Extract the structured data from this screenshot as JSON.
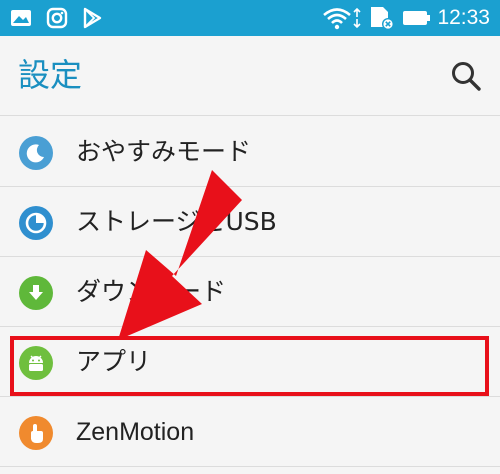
{
  "status_bar": {
    "time": "12:33",
    "left_icons": [
      "gallery-icon",
      "instagram-icon",
      "play-store-icon"
    ],
    "right_icons": [
      "wifi-icon",
      "sd-card-icon",
      "battery-icon"
    ]
  },
  "header": {
    "title": "設定",
    "search_icon": "search-icon"
  },
  "settings": {
    "items": [
      {
        "label": "おやすみモード",
        "icon": "moon-icon",
        "color": "#4a9fd4"
      },
      {
        "label": "ストレージとUSB",
        "icon": "storage-icon",
        "color": "#2f8fcf"
      },
      {
        "label": "ダウンロード",
        "icon": "download-icon",
        "color": "#5fb83a"
      },
      {
        "label": "アプリ",
        "icon": "android-icon",
        "color": "#6fbf3e"
      },
      {
        "label": "ZenMotion",
        "icon": "gesture-icon",
        "color": "#f08a2e"
      }
    ]
  },
  "annotation": {
    "arrow_color": "#e8101a",
    "highlight_color": "#e8101a"
  },
  "colors": {
    "status_bar": "#1ba0d0",
    "title": "#1a8fc0"
  }
}
